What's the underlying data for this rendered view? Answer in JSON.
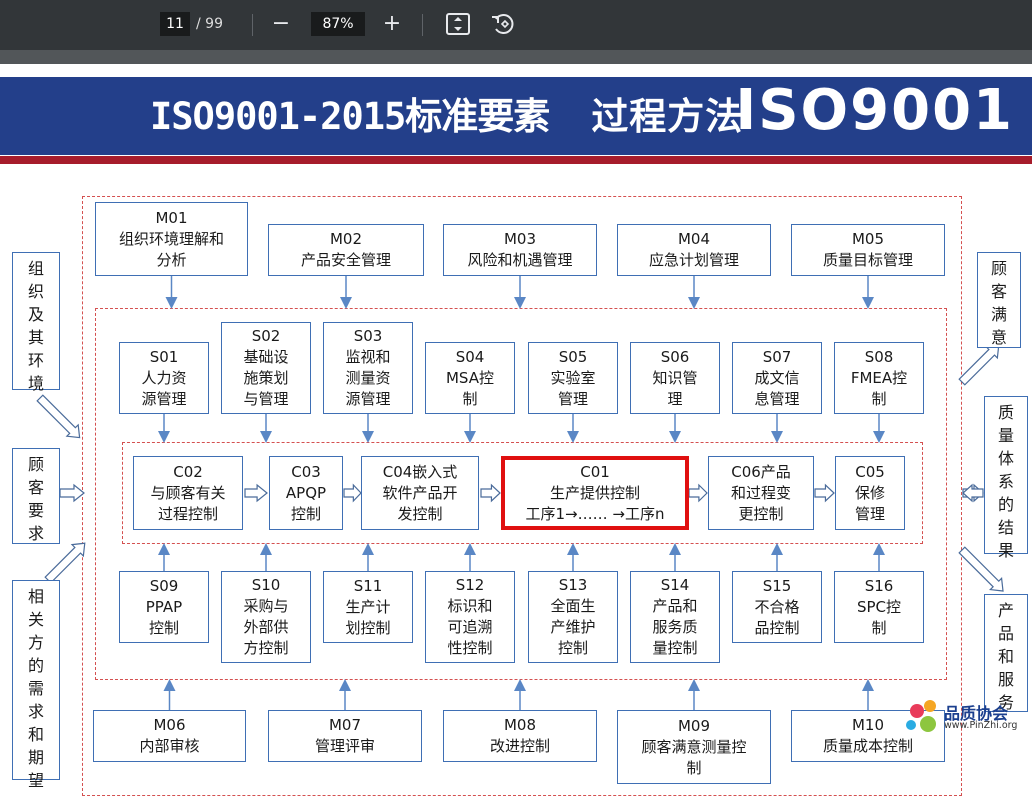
{
  "viewer": {
    "page_current": "11",
    "page_separator": "/",
    "page_total": "99",
    "zoom_out": "−",
    "zoom": "87%",
    "zoom_in": "+"
  },
  "slide": {
    "title_left": "ISO9001-2015标准要素",
    "title_mid": "过程方法",
    "title_right": "ISO9001"
  },
  "m_top": [
    {
      "code": "M01",
      "label": "组织环境理解和\n分析"
    },
    {
      "code": "M02",
      "label": "产品安全管理"
    },
    {
      "code": "M03",
      "label": "风险和机遇管理"
    },
    {
      "code": "M04",
      "label": "应急计划管理"
    },
    {
      "code": "M05",
      "label": "质量目标管理"
    }
  ],
  "s_top": [
    {
      "code": "S01",
      "label": "人力资\n源管理"
    },
    {
      "code": "S02",
      "label": "基础设\n施策划\n与管理"
    },
    {
      "code": "S03",
      "label": "监视和\n测量资\n源管理"
    },
    {
      "code": "S04",
      "label": "MSA控\n制"
    },
    {
      "code": "S05",
      "label": "实验室\n管理"
    },
    {
      "code": "S06",
      "label": "知识管\n理"
    },
    {
      "code": "S07",
      "label": "成文信\n息管理"
    },
    {
      "code": "S08",
      "label": "FMEA控\n制"
    }
  ],
  "c_row": [
    {
      "code": "C02",
      "label": "与顾客有关\n过程控制"
    },
    {
      "code": "C03",
      "label": "APQP\n控制"
    },
    {
      "code": "C04嵌入式",
      "label": "软件产品开\n发控制"
    },
    {
      "code": "C01",
      "label": "生产提供控制\n工序1→…… →工序n"
    },
    {
      "code": "C06产品",
      "label": "和过程变\n更控制"
    },
    {
      "code": "C05",
      "label": "保修\n管理"
    }
  ],
  "s_bottom": [
    {
      "code": "S09",
      "label": "PPAP\n控制"
    },
    {
      "code": "S10",
      "label": "采购与\n外部供\n方控制"
    },
    {
      "code": "S11",
      "label": "生产计\n划控制"
    },
    {
      "code": "S12",
      "label": "标识和\n可追溯\n性控制"
    },
    {
      "code": "S13",
      "label": "全面生\n产维护\n控制"
    },
    {
      "code": "S14",
      "label": "产品和\n服务质\n量控制"
    },
    {
      "code": "S15",
      "label": "不合格\n品控制"
    },
    {
      "code": "S16",
      "label": "SPC控\n制"
    }
  ],
  "m_bottom": [
    {
      "code": "M06",
      "label": "内部审核"
    },
    {
      "code": "M07",
      "label": "管理评审"
    },
    {
      "code": "M08",
      "label": "改进控制"
    },
    {
      "code": "M09",
      "label": "顾客满意测量控\n制"
    },
    {
      "code": "M10",
      "label": "质量成本控制"
    }
  ],
  "inputs": [
    {
      "chars": [
        "组",
        "织",
        "及",
        "其",
        "环",
        "境"
      ]
    },
    {
      "chars": [
        "顾",
        "客",
        "要",
        "求"
      ]
    },
    {
      "chars": [
        "相",
        "关",
        "方",
        "的",
        "需",
        "求",
        "和",
        "期",
        "望"
      ]
    }
  ],
  "outputs": [
    {
      "chars": [
        "顾",
        "客",
        "满",
        "意"
      ]
    },
    {
      "chars": [
        "质",
        "量",
        "体",
        "系",
        "的",
        "结",
        "果"
      ]
    },
    {
      "chars": [
        "产",
        "品",
        "和",
        "服",
        "务"
      ]
    }
  ],
  "logo": {
    "name": "品质协会",
    "url": "www.PinZhi.org"
  }
}
